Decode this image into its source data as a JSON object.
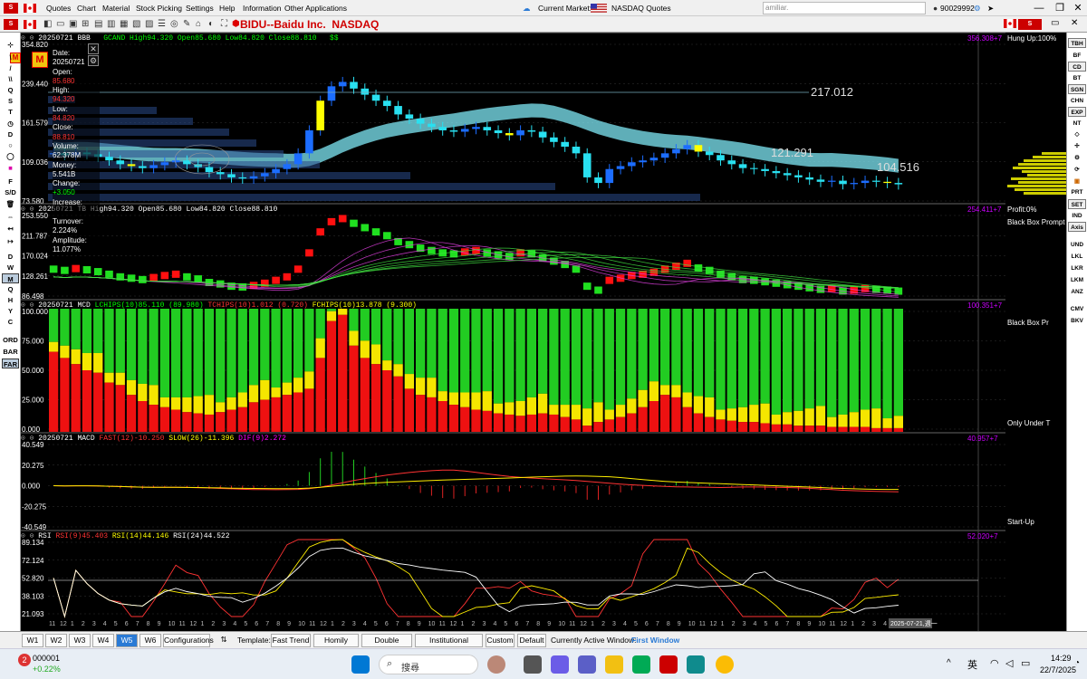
{
  "menubar": {
    "items": [
      "Quotes",
      "Chart",
      "Material",
      "Stock Picking",
      "Settings",
      "Help",
      "Information",
      "Other Applications"
    ],
    "current_market_label": "Current Market:",
    "market_value": "NASDAQ Quotes",
    "search_text": "amiliar.",
    "account": "90029992"
  },
  "title": {
    "symbol": "BIDU--Baidu Inc.",
    "exchange": "NASDAQ"
  },
  "left_tools": [
    "M",
    "\\",
    "/",
    "\\\\",
    "Q",
    "S",
    "T",
    "D",
    "F",
    "S/D",
    "D",
    "W",
    "M",
    "Q",
    "H",
    "Y",
    "C",
    "ORD",
    "BAR",
    "FAR"
  ],
  "right_tools": [
    "TBH",
    "BF",
    "CD",
    "BT",
    "SGN",
    "CHN",
    "EXP",
    "NT",
    "PRT",
    "SET",
    "IND",
    "Axis",
    "UND",
    "LKL",
    "LKR",
    "LKM",
    "ANZ",
    "CMV",
    "BKV"
  ],
  "side_labels": {
    "hung_up": "Hung Up:100%",
    "profit": "Profit:0%",
    "black_box_prompt": "Black Box Prompt",
    "black_box_pr": "Black Box Pr",
    "only_under": "Only Under T",
    "start_up": "Start-Up"
  },
  "panel1": {
    "header": "20250721 BBB",
    "header2": "GCAND High94.320 Open85.680 Low84.820 Close88.810",
    "header3": "$$",
    "right_value": "356.308+7",
    "y_labels": [
      "354.820",
      "239.440",
      "161.579",
      "109.036",
      "73.580"
    ],
    "level_labels": [
      "217.012",
      "121.291",
      "104.516"
    ]
  },
  "tooltip": {
    "date_label": "Date:",
    "date": "20250721",
    "open_label": "Open:",
    "open": "85.680",
    "high_label": "High:",
    "high": "94.320",
    "low_label": "Low:",
    "low": "84.820",
    "close_label": "Close:",
    "close": "88.810",
    "volume_label": "Volume:",
    "volume": "62.378M",
    "money_label": "Money:",
    "money": "5.541B",
    "change_label": "Change:",
    "change": "+3.050",
    "increase_label": "Increase:",
    "turnover_label": "Turnover:",
    "turnover": "2.224%",
    "amplitude_label": "Amplitude:",
    "amplitude": "11.077%"
  },
  "panel2": {
    "header": "20250721 TB High94.320 Open85.680 Low84.820 Close88.810",
    "right_value": "254.411+7",
    "y_labels": [
      "253.550",
      "211.787",
      "170.024",
      "128.261",
      "86.498"
    ]
  },
  "panel3": {
    "header1": "20250721 MCD",
    "header2": "LCHIPS(10)85.110 (89.980)",
    "header3": "TCHIPS(10)1.012 (0.720)",
    "header4": "FCHIPS(10)13.878 (9.300)",
    "right_value": "100.351+7",
    "y_labels": [
      "100.000",
      "75.000",
      "50.000",
      "25.000",
      "0.000"
    ]
  },
  "panel4": {
    "header1": "20250721 MACD",
    "header2": "FAST(12)-10.250",
    "header3": "SLOW(26)-11.396",
    "header4": "DIF(9)2.272",
    "right_value": "40.957+7",
    "y_labels": [
      "40.549",
      "20.275",
      "0.000",
      "-20.275",
      "-40.549"
    ]
  },
  "panel5": {
    "header1": "RSI",
    "header2": "RSI(9)45.403",
    "header3": "RSI(14)44.146",
    "header4": "RSI(24)44.522",
    "right_value": "52.020+7",
    "y_labels": [
      "89.134",
      "72.124",
      "52.820",
      "38.103",
      "21.093"
    ]
  },
  "x_axis": {
    "ticks": [
      "11",
      "12",
      "1",
      "2",
      "3",
      "4",
      "5",
      "6",
      "7",
      "8",
      "9",
      "10",
      "11",
      "12",
      "1",
      "2",
      "3",
      "4",
      "5",
      "6",
      "7",
      "8",
      "9",
      "10",
      "11",
      "12",
      "1",
      "2",
      "3",
      "4",
      "5",
      "6",
      "7",
      "8",
      "9",
      "10",
      "11",
      "12",
      "1",
      "2",
      "3",
      "4",
      "5",
      "6",
      "7",
      "8",
      "9",
      "10",
      "11",
      "12",
      "1",
      "2",
      "3",
      "4",
      "5",
      "6",
      "7",
      "8",
      "9",
      "10",
      "11",
      "12",
      "1",
      "2",
      "3",
      "4",
      "5",
      "6",
      "7",
      "8",
      "9",
      "10",
      "11",
      "12",
      "1",
      "2",
      "3",
      "4",
      "5"
    ],
    "current_date": "2025-07-21,週一"
  },
  "bottom_tabs": [
    "W1",
    "W2",
    "W3",
    "W4",
    "W5",
    "W6",
    "Configurations"
  ],
  "template_label": "Template:",
  "templates": [
    "Fast Trend",
    "Homily Wave",
    "Double Swords",
    "Institutional Arbitrage",
    "Custom",
    "Default"
  ],
  "active_window_label": "Currently Active Window:",
  "active_window": "First Window",
  "taskbar": {
    "stock_code": "000001",
    "stock_change": "+0.22%",
    "badge": "2",
    "search_placeholder": "搜尋",
    "lang": "英",
    "time": "14:29",
    "date": "22/7/2025"
  },
  "chart_data": [
    {
      "type": "candlestick",
      "title": "BIDU--Baidu Inc.",
      "ylim": [
        73.58,
        354.82
      ],
      "last": {
        "open": 85.68,
        "high": 94.32,
        "low": 84.82,
        "close": 88.81
      },
      "series": [
        {
          "name": "GCAND",
          "close": [
            120,
            118,
            121,
            119,
            116,
            112,
            108,
            106,
            104,
            107,
            110,
            112,
            108,
            105,
            100,
            98,
            95,
            94,
            96,
            99,
            103,
            108,
            120,
            150,
            200,
            230,
            240,
            225,
            212,
            200,
            190,
            175,
            168,
            160,
            155,
            150,
            148,
            152,
            155,
            150,
            146,
            143,
            150,
            148,
            140,
            134,
            128,
            120,
            95,
            90,
            103,
            106,
            110,
            112,
            115,
            120,
            125,
            130,
            122,
            118,
            112,
            108,
            104,
            103,
            101,
            99,
            97,
            95,
            93,
            91,
            92,
            89,
            90,
            92,
            91,
            90,
            88.81
          ]
        }
      ]
    },
    {
      "type": "bar",
      "title": "MCD",
      "ylim": [
        0,
        100
      ],
      "series": [
        {
          "name": "LCHIPS(10)",
          "values": [
            65,
            60,
            55,
            50,
            48,
            40,
            38,
            30,
            25,
            22,
            20,
            18,
            16,
            15,
            14,
            16,
            18,
            20,
            24,
            26,
            28,
            30,
            32,
            35,
            60,
            90,
            95,
            70,
            60,
            55,
            50,
            45,
            35,
            30,
            28,
            25,
            22,
            20,
            18,
            17,
            15,
            14,
            13,
            14,
            15,
            14,
            12,
            10,
            5,
            8,
            10,
            12,
            15,
            20,
            25,
            30,
            28,
            20,
            15,
            12,
            10,
            9,
            8,
            8,
            7,
            6,
            6,
            5,
            5,
            5,
            4,
            4,
            4,
            4,
            3,
            3,
            3
          ]
        }
      ]
    },
    {
      "type": "line",
      "title": "MACD",
      "ylim": [
        -40.549,
        40.549
      ],
      "series": [
        {
          "name": "FAST(12)",
          "values": []
        },
        {
          "name": "SLOW(26)",
          "values": []
        }
      ]
    },
    {
      "type": "line",
      "title": "RSI",
      "ylim": [
        21.093,
        89.134
      ],
      "series": [
        {
          "name": "RSI(9)",
          "values": []
        },
        {
          "name": "RSI(14)",
          "values": []
        },
        {
          "name": "RSI(24)",
          "values": []
        }
      ]
    }
  ]
}
